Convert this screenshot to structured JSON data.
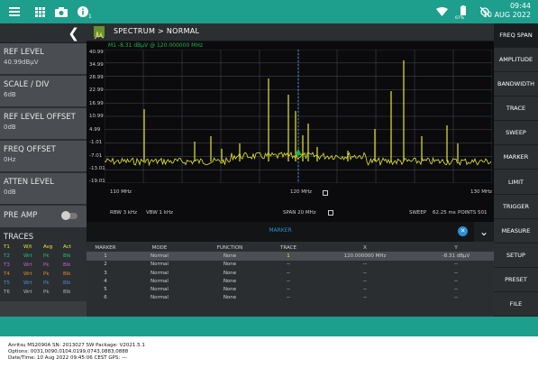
{
  "status_bar": {
    "notification_count": "1",
    "battery_percent": "67%",
    "time": "09:44",
    "date": "10 AUG 2022"
  },
  "left_panel": {
    "items": [
      {
        "label": "REF LEVEL",
        "value": "40.99dBμV"
      },
      {
        "label": "SCALE / DIV",
        "value": "6dB"
      },
      {
        "label": "REF LEVEL OFFSET",
        "value": "0dB"
      },
      {
        "label": "FREQ OFFSET",
        "value": "0Hz"
      },
      {
        "label": "ATTEN LEVEL",
        "value": "0dB"
      }
    ],
    "preamp_label": "PRE AMP",
    "traces_title": "TRACES",
    "traces_header": [
      "T1",
      "W/t",
      "Avg",
      "Act"
    ],
    "traces_rows": [
      [
        "T2",
        "Wrt",
        "Pk",
        "Blk"
      ],
      [
        "T3",
        "Wrt",
        "Pk",
        "Blk"
      ],
      [
        "T4",
        "Wrt",
        "Pk",
        "Blk"
      ],
      [
        "T5",
        "Wrt",
        "Pk",
        "Blk"
      ],
      [
        "T6",
        "Wrt",
        "Pk",
        "Blk"
      ]
    ]
  },
  "header": {
    "title": "SPECTRUM  >  NORMAL"
  },
  "spectrum": {
    "marker_readout": "M1   -8.31 dBμV @ 120.000000 MHz",
    "y_labels": [
      "40.99",
      "34.99",
      "28.99",
      "22.99",
      "16.99",
      "10.99",
      "4.99",
      "-1.01",
      "-7.01",
      "-13.01",
      "-19.01"
    ],
    "start_freq": "110 MHz",
    "center_freq": "120 MHz",
    "stop_freq": "130 MHz",
    "rbw": "RBW 3 kHz",
    "vbw": "VBW 1 kHz",
    "span": "SPAN 20 MHz",
    "sweep_label": "SWEEP",
    "sweep_time": "62.25 ms",
    "points": "POINTS 501"
  },
  "marker_panel": {
    "title": "MARKER",
    "columns": [
      "MARKER",
      "MODE",
      "FUNCTION",
      "TRACE",
      "X",
      "Y"
    ],
    "rows": [
      [
        "1",
        "Normal",
        "None",
        "1",
        "120.000000 MHz",
        "-8.31 dBμV"
      ],
      [
        "2",
        "Normal",
        "None",
        "--",
        "--",
        "--"
      ],
      [
        "3",
        "Normal",
        "None",
        "--",
        "--",
        "--"
      ],
      [
        "4",
        "Normal",
        "None",
        "--",
        "--",
        "--"
      ],
      [
        "5",
        "Normal",
        "None",
        "--",
        "--",
        "--"
      ],
      [
        "6",
        "Normal",
        "None",
        "--",
        "--",
        "--"
      ]
    ]
  },
  "right_menu": [
    "FREQ SPAN",
    "AMPLITUDE",
    "BANDWIDTH",
    "TRACE",
    "SWEEP",
    "MARKER",
    "LIMIT",
    "TRIGGER",
    "MEASURE",
    "SETUP",
    "PRESET",
    "FILE"
  ],
  "footer": {
    "line1": "Anritsu MS2090A SN: 2013027 SW Package: V2021.5.1",
    "line2": "Options: 0031,0090,0104,0199,0743,0883,0888",
    "line3": "Date/Time: 10 Aug 2022 09:45:06 CEST GPS: ---"
  },
  "colors": {
    "teal": "#1e9e8c",
    "trace": "#e5e835",
    "marker": "#21b14b",
    "accent_blue": "#2a8fd6"
  }
}
